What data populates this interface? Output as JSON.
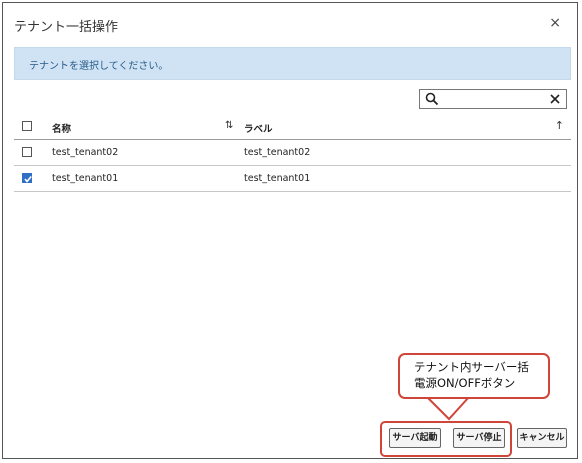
{
  "dialog": {
    "title": "テナント一括操作",
    "close_label": "×"
  },
  "info": {
    "message": "テナントを選択してください。"
  },
  "search": {
    "value": "",
    "placeholder": ""
  },
  "table": {
    "columns": [
      "名称",
      "ラベル"
    ],
    "rows": [
      {
        "name": "test_tenant02",
        "label": "test_tenant02",
        "checked": false
      },
      {
        "name": "test_tenant01",
        "label": "test_tenant01",
        "checked": true
      }
    ]
  },
  "buttons": {
    "start_server": "サーバ起動",
    "stop_server": "サーバ停止",
    "cancel": "キャンセル"
  },
  "callout": {
    "line1": "テナント内サーバー括",
    "line2": "電源ON/OFFボタン"
  },
  "colors": {
    "info_bg": "#cfe3f4",
    "highlight": "#d0453a",
    "checkbox_checked": "#2f6fc4"
  },
  "icons": [
    "close-icon",
    "search-icon",
    "clear-icon",
    "sort-icon",
    "sort-ascending-icon",
    "checkbox-icon"
  ]
}
